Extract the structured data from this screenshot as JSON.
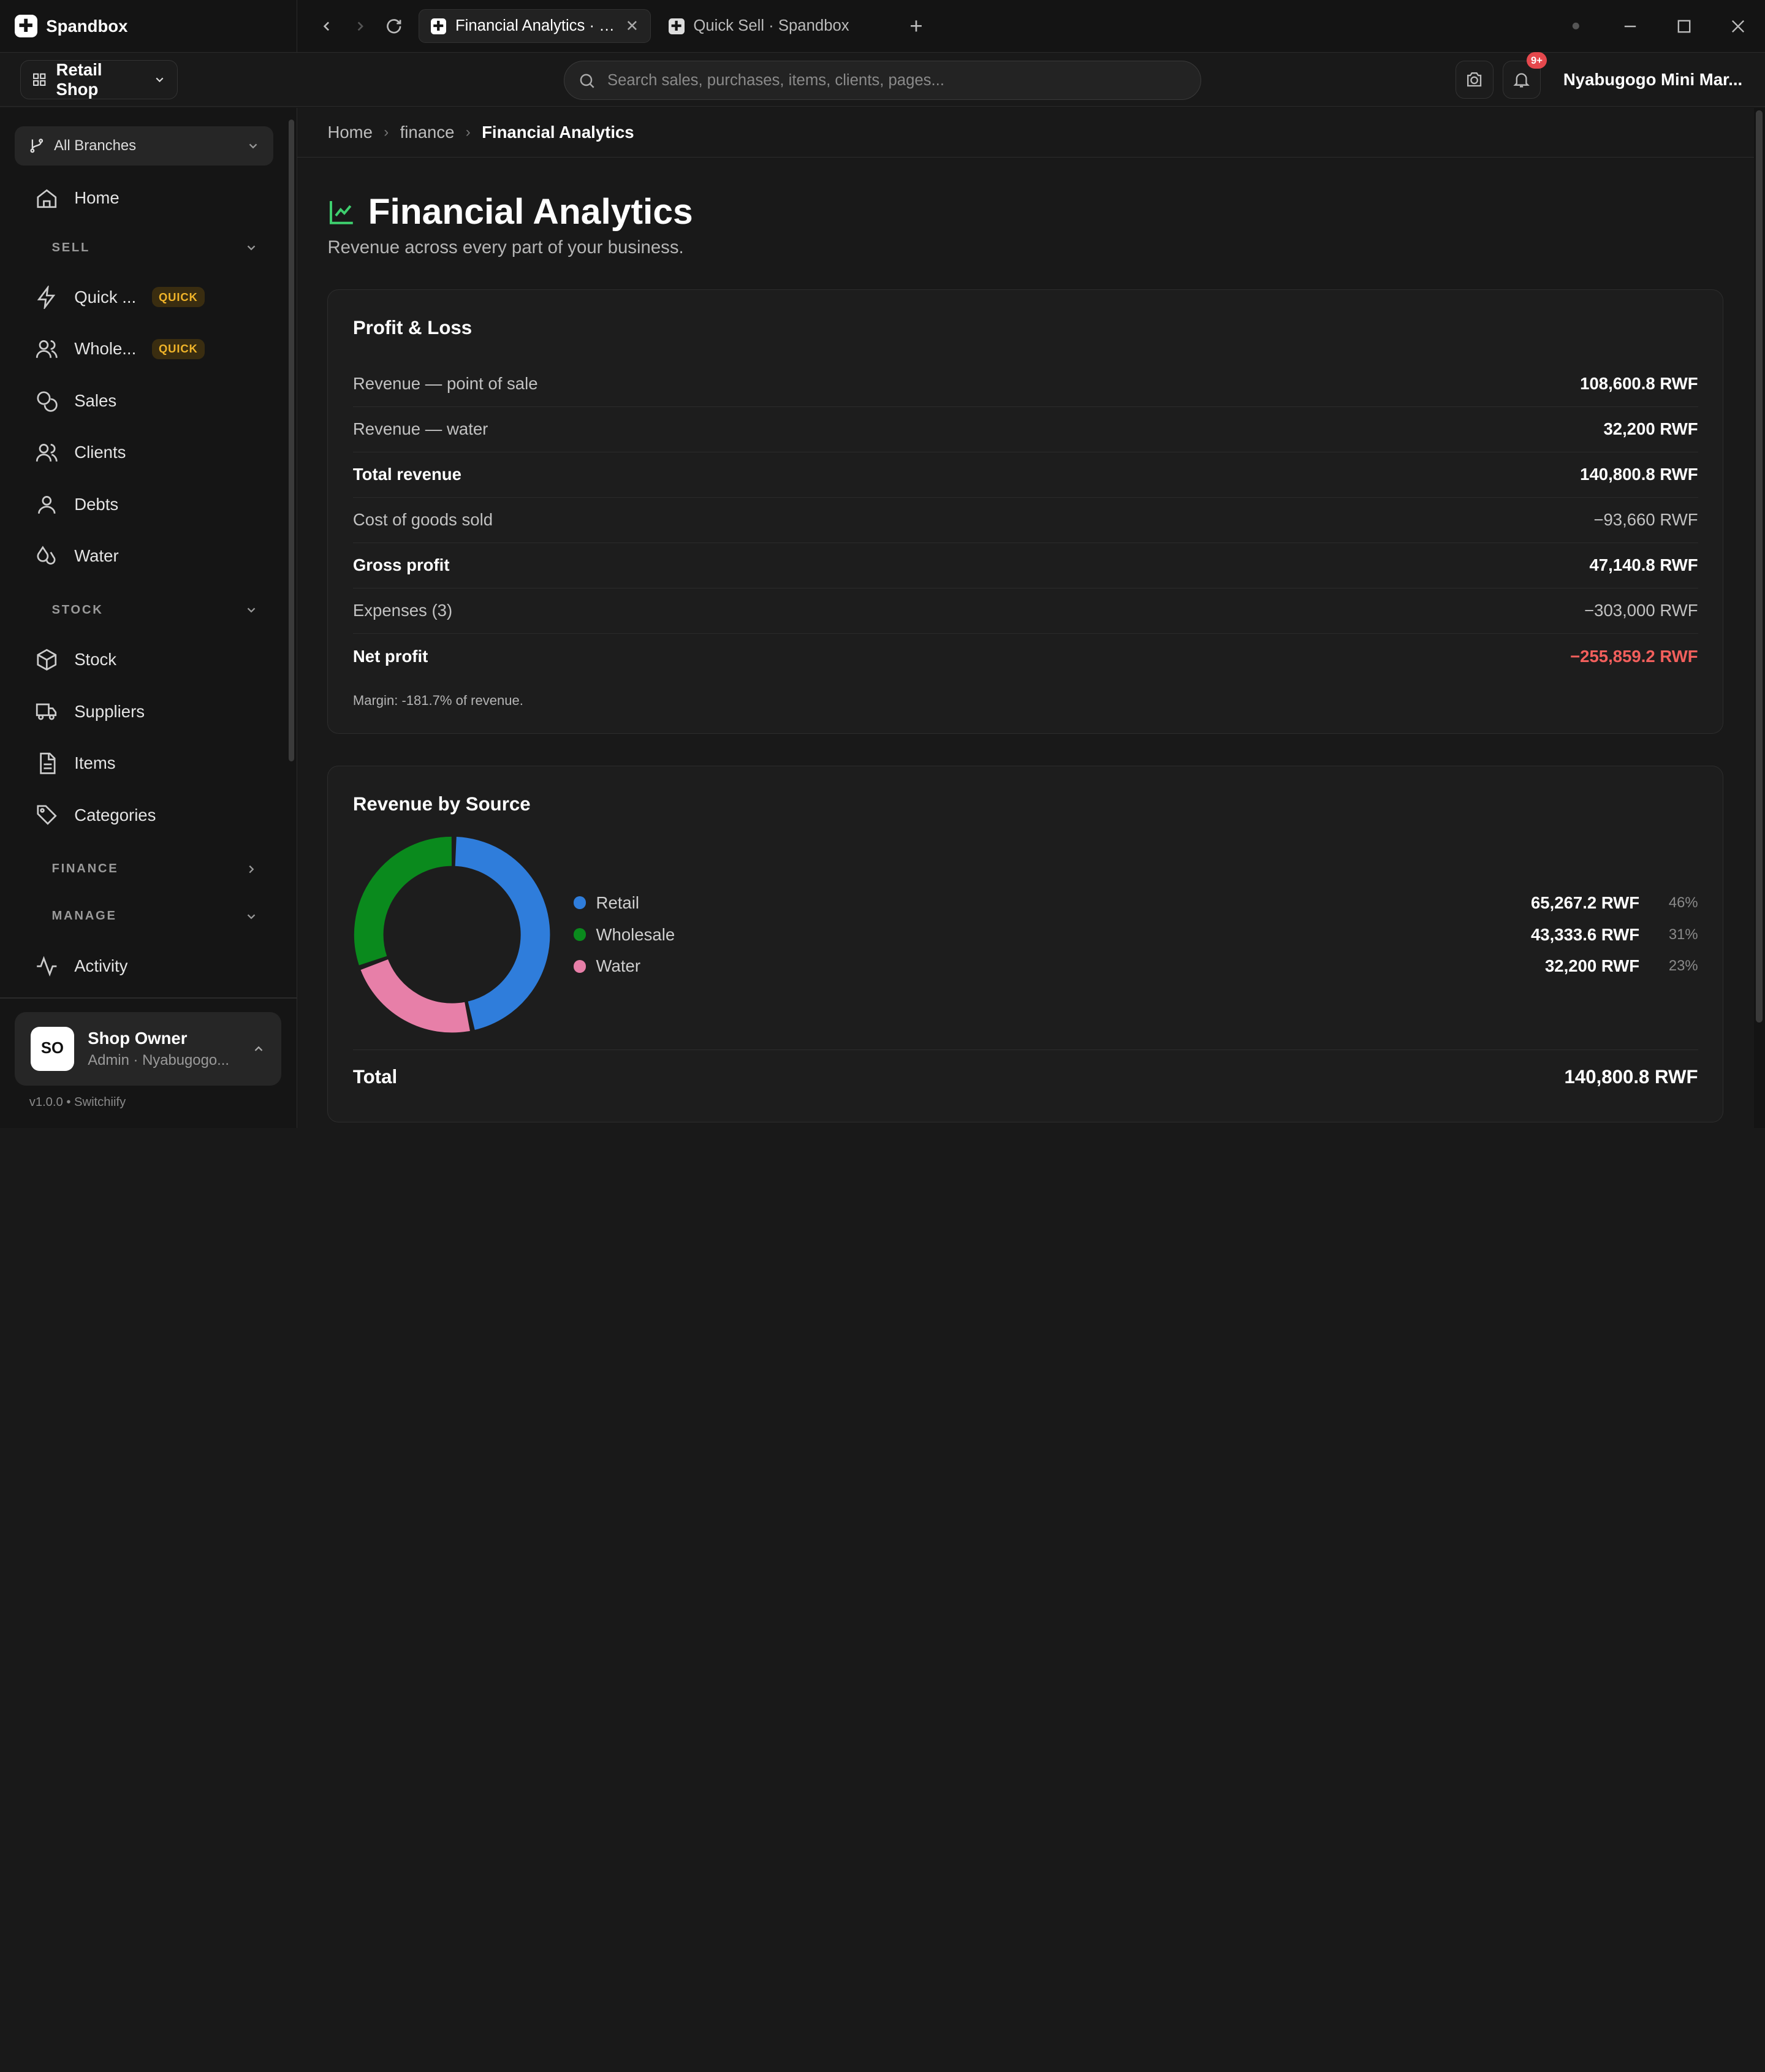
{
  "app": {
    "name": "Spandbox"
  },
  "tabs": [
    {
      "label": "Financial Analytics · Spandbox",
      "active": true
    },
    {
      "label": "Quick Sell · Spandbox",
      "active": false
    }
  ],
  "topbar": {
    "shop": "Retail Shop",
    "search_placeholder": "Search sales, purchases, items, clients, pages...",
    "notifications_badge": "9+",
    "org_name": "Nyabugogo Mini Mar..."
  },
  "sidebar": {
    "branch": "All Branches",
    "home": "Home",
    "sell_section": "SELL",
    "quick_sell": "Quick ...",
    "wholesale": "Whole...",
    "quick_badge": "QUICK",
    "sales": "Sales",
    "clients": "Clients",
    "debts": "Debts",
    "water": "Water",
    "stock_section": "STOCK",
    "stock": "Stock",
    "suppliers": "Suppliers",
    "items": "Items",
    "categories": "Categories",
    "finance_section": "FINANCE",
    "manage_section": "MANAGE",
    "activity": "Activity"
  },
  "user": {
    "initials": "SO",
    "name": "Shop Owner",
    "role": "Admin · Nyabugogo..."
  },
  "version": "v1.0.0 • Switchiify",
  "breadcrumb": {
    "home": "Home",
    "section": "finance",
    "current": "Financial Analytics"
  },
  "page": {
    "title": "Financial Analytics",
    "subtitle": "Revenue across every part of your business."
  },
  "profit_loss": {
    "title": "Profit & Loss",
    "rows": [
      {
        "label": "Revenue — point of sale",
        "value": "108,600.8 RWF"
      },
      {
        "label": "Revenue — water",
        "value": "32,200 RWF"
      },
      {
        "label": "Total revenue",
        "value": "140,800.8 RWF"
      },
      {
        "label": "Cost of goods sold",
        "value": "−93,660 RWF"
      },
      {
        "label": "Gross profit",
        "value": "47,140.8 RWF"
      },
      {
        "label": "Expenses (3)",
        "value": "−303,000 RWF"
      },
      {
        "label": "Net profit",
        "value": "−255,859.2 RWF"
      }
    ],
    "margin_note": "Margin: -181.7% of revenue."
  },
  "revenue_by_source": {
    "title": "Revenue by Source",
    "sources": [
      {
        "name": "Retail",
        "value": "65,267.2 RWF",
        "pct": "46%",
        "fraction": 0.4635,
        "color": "#2f7ddb"
      },
      {
        "name": "Wholesale",
        "value": "43,333.6 RWF",
        "pct": "31%",
        "fraction": 0.3078,
        "color": "#0a8a1d"
      },
      {
        "name": "Water",
        "value": "32,200 RWF",
        "pct": "23%",
        "fraction": 0.2287,
        "color": "#e77fa8"
      }
    ],
    "total_label": "Total",
    "total_value": "140,800.8 RWF"
  }
}
